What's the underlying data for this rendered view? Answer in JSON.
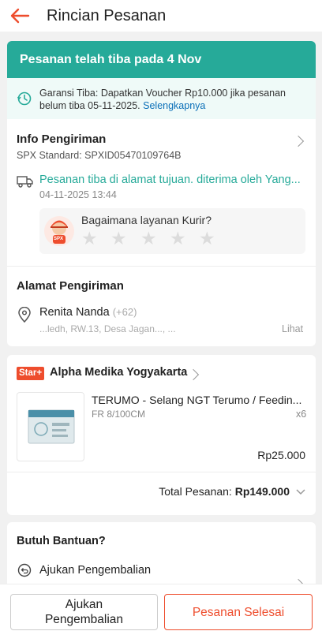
{
  "header": {
    "title": "Rincian Pesanan"
  },
  "banner": {
    "text": "Pesanan telah tiba pada 4 Nov"
  },
  "guarantee": {
    "text": "Garansi Tiba: Dapatkan Voucher Rp10.000 jika pesanan belum tiba 05-11-2025.",
    "link": "Selengkapnya"
  },
  "shipping": {
    "title": "Info Pengiriman",
    "service": "SPX Standard: SPXID05470109764B",
    "status": "Pesanan tiba di alamat tujuan. diterima oleh Yang...",
    "timestamp": "04-11-2025 13:44",
    "rating_prompt": "Bagaimana layanan Kurir?",
    "courier_badge": "SPX",
    "stars": 5
  },
  "address": {
    "title": "Alamat Pengiriman",
    "name": "Renita Nanda",
    "phone": "(+62) ",
    "detail": "...ledh, RW.13, Desa Jagan..., ...",
    "more": "Lihat"
  },
  "shop": {
    "badge": "Star+",
    "name": "Alpha Medika Yogyakarta",
    "product_name": "TERUMO - Selang NGT Terumo / Feedin...",
    "variant": "FR 8/100CM",
    "qty": "x6",
    "price": "Rp25.000",
    "total_label": "Total Pesanan:",
    "total_value": "Rp149.000"
  },
  "help": {
    "title": "Butuh Bantuan?",
    "item1": "Ajukan Pengembalian"
  },
  "actions": {
    "return_line1": "Ajukan",
    "return_line2": "Pengembalian",
    "complete": "Pesanan Selesai"
  },
  "colors": {
    "accent": "#ee4d2d",
    "teal": "#26aa99",
    "link": "#0a6fb8"
  }
}
